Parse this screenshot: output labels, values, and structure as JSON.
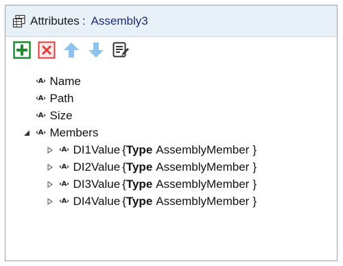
{
  "header": {
    "icon": "attributes-table-icon",
    "label": "Attributes",
    "colon": ":",
    "target": "Assembly3"
  },
  "toolbar": {
    "buttons": [
      {
        "icon": "add-icon",
        "color": "#1e8a2e"
      },
      {
        "icon": "delete-icon",
        "color": "#e23b3b"
      },
      {
        "icon": "arrow-up-icon",
        "color": "#8cc3ef"
      },
      {
        "icon": "arrow-down-icon",
        "color": "#8cc3ef"
      },
      {
        "icon": "edit-list-icon",
        "color": "#333333"
      }
    ]
  },
  "attr_icon_text": "‹A›",
  "tree": {
    "items": [
      {
        "name": "Name"
      },
      {
        "name": "Path"
      },
      {
        "name": "Size"
      },
      {
        "name": "Members",
        "expanded": true
      }
    ],
    "members": [
      {
        "name": "DI1Value",
        "open": "{",
        "type_kw": "Type",
        "type_name": "AssemblyMember",
        "close": "}"
      },
      {
        "name": "DI2Value",
        "open": "{",
        "type_kw": "Type",
        "type_name": "AssemblyMember",
        "close": "}"
      },
      {
        "name": "DI3Value",
        "open": "{",
        "type_kw": "Type",
        "type_name": "AssemblyMember",
        "close": "}"
      },
      {
        "name": "DI4Value",
        "open": "{",
        "type_kw": "Type",
        "type_name": "AssemblyMember",
        "close": "}"
      }
    ]
  }
}
